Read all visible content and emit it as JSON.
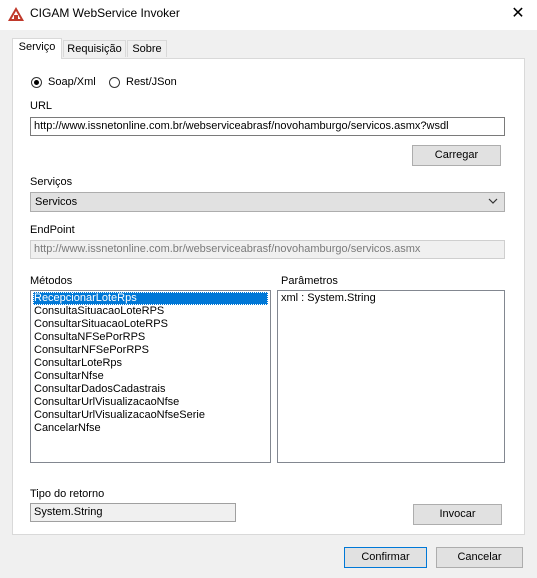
{
  "window": {
    "title": "CIGAM WebService Invoker"
  },
  "tabs": [
    "Serviço",
    "Requisição",
    "Sobre"
  ],
  "protocol": {
    "options": [
      "Soap/Xml",
      "Rest/JSon"
    ],
    "selected": "Soap/Xml"
  },
  "url": {
    "label": "URL",
    "value": "http://www.issnetonline.com.br/webserviceabrasf/novohamburgo/servicos.asmx?wsdl"
  },
  "carregar_label": "Carregar",
  "servicos": {
    "label": "Serviços",
    "selected": "Servicos"
  },
  "endpoint": {
    "label": "EndPoint",
    "value": "http://www.issnetonline.com.br/webserviceabrasf/novohamburgo/servicos.asmx"
  },
  "metodos": {
    "label": "Métodos",
    "items": [
      "RecepcionarLoteRps",
      "ConsultaSituacaoLoteRPS",
      "ConsultarSituacaoLoteRPS",
      "ConsultaNFSePorRPS",
      "ConsultarNFSePorRPS",
      "ConsultarLoteRps",
      "ConsultarNfse",
      "ConsultarDadosCadastrais",
      "ConsultarUrlVisualizacaoNfse",
      "ConsultarUrlVisualizacaoNfseSerie",
      "CancelarNfse"
    ],
    "selected_index": 0
  },
  "parametros": {
    "label": "Parâmetros",
    "items": [
      "xml : System.String"
    ]
  },
  "tipo_retorno": {
    "label": "Tipo do retorno",
    "value": "System.String"
  },
  "invocar_label": "Invocar",
  "footer": {
    "confirm_label": "Confirmar",
    "cancel_label": "Cancelar"
  },
  "colors": {
    "selection": "#0078d7",
    "app_icon": "#c0392b"
  }
}
